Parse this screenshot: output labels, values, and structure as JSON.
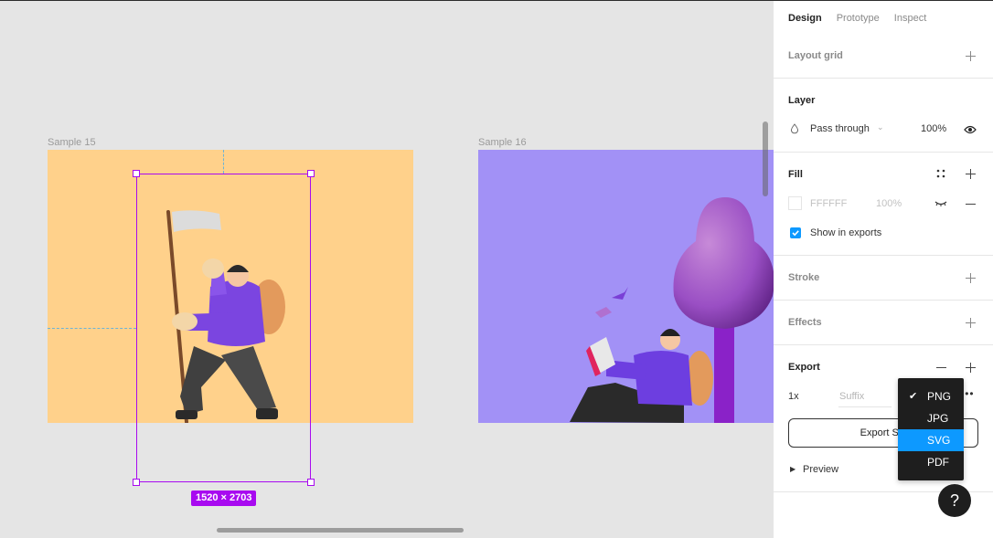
{
  "canvas": {
    "frames": [
      {
        "name": "Sample 15",
        "bg": "#ffd18b"
      },
      {
        "name": "Sample 16",
        "bg": "#a291f6"
      }
    ],
    "selection": {
      "dimensions": "1520 × 2703",
      "color": "#a80af0"
    }
  },
  "panel": {
    "tabs": [
      {
        "label": "Design",
        "active": true
      },
      {
        "label": "Prototype",
        "active": false
      },
      {
        "label": "Inspect",
        "active": false
      }
    ],
    "layout_grid": {
      "title": "Layout grid"
    },
    "layer": {
      "title": "Layer",
      "blend_mode": "Pass through",
      "opacity": "100%"
    },
    "fill": {
      "title": "Fill",
      "hex": "FFFFFF",
      "opacity": "100%",
      "show_in_exports_label": "Show in exports",
      "show_in_exports": true
    },
    "stroke": {
      "title": "Stroke"
    },
    "effects": {
      "title": "Effects"
    },
    "export": {
      "title": "Export",
      "scale": "1x",
      "suffix_placeholder": "Suffix",
      "button_label": "Export Sal",
      "preview_label": "Preview",
      "format_options": [
        {
          "label": "PNG",
          "checked": true,
          "highlighted": false
        },
        {
          "label": "JPG",
          "checked": false,
          "highlighted": false
        },
        {
          "label": "SVG",
          "checked": false,
          "highlighted": true
        },
        {
          "label": "PDF",
          "checked": false,
          "highlighted": false
        }
      ]
    },
    "help_label": "?"
  },
  "colors": {
    "accent": "#0d99ff",
    "selection": "#a80af0",
    "guide": "#6db3d6"
  }
}
